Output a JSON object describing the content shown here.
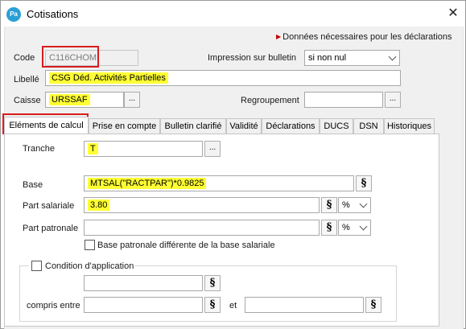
{
  "window": {
    "icon_text": "Pa",
    "title": "Cotisations",
    "close_glyph": "✕"
  },
  "note": "Données nécessaires pour les déclarations",
  "form": {
    "code_label": "Code",
    "code_value": "C116CHOM",
    "impression_label": "Impression sur bulletin",
    "impression_value": "si non nul",
    "libelle_label": "Libellé",
    "libelle_value": "CSG Déd. Activités Partielles",
    "caisse_label": "Caisse",
    "caisse_value": "URSSAF",
    "regroupement_label": "Regroupement",
    "regroupement_value": "",
    "dots": "..."
  },
  "tabs": [
    {
      "label": "Eléments de calcul",
      "active": true
    },
    {
      "label": "Prise en compte"
    },
    {
      "label": "Bulletin clarifié"
    },
    {
      "label": "Validité"
    },
    {
      "label": "Déclarations"
    },
    {
      "label": "DUCS"
    },
    {
      "label": "DSN"
    },
    {
      "label": "Historiques"
    }
  ],
  "calc": {
    "tranche_label": "Tranche",
    "tranche_value": "T",
    "base_label": "Base",
    "base_value": "MTSAL(\"RACTPAR\")*0.9825",
    "part_salariale_label": "Part salariale",
    "part_salariale_value": "3.80",
    "part_salariale_unit": "%",
    "part_patronale_label": "Part patronale",
    "part_patronale_value": "",
    "part_patronale_unit": "%",
    "base_patronale_diff_label": "Base patronale différente de la base salariale",
    "formula_glyph": "§"
  },
  "condition": {
    "label": "Condition d'application",
    "value": "",
    "compris_entre_label": "compris entre",
    "from_value": "",
    "et_label": "et",
    "to_value": ""
  },
  "colors": {
    "highlight": "#ffff33",
    "red_box": "#d81d1d",
    "icon_blue": "#2a9fd6"
  }
}
